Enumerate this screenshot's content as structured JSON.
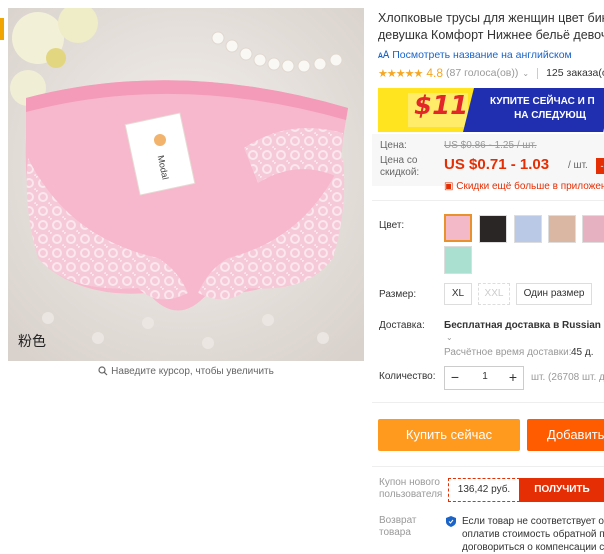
{
  "product": {
    "title_line1": "Хлопковые трусы для женщин цвет бики",
    "title_line2": "девушка Комфорт Нижнее бельё девоче",
    "translate_link": "Посмотреть название на английском",
    "rating": "4.8",
    "votes": "(87 голоса(ов))",
    "orders": "125 заказа(ов",
    "image_caption": "粉色",
    "image_tag": "Modal",
    "zoom_hint": "Наведите курсор, чтобы увеличить"
  },
  "banner": {
    "amount": "$11",
    "cta_line1": "КУПИТЕ СЕЙЧАС И П",
    "cta_line2": "НА СЛЕДУЮЩ"
  },
  "price": {
    "price_label": "Цена:",
    "old_price": "US $0.86 - 1.25 / шт.",
    "discount_label_line1": "Цена со",
    "discount_label_line2": "скидкой:",
    "sale_price": "US $0.71 - 1.03",
    "per_unit": "/ шт.",
    "app_discount": "Скидки ещё больше в приложен"
  },
  "options": {
    "color_label": "Цвет:",
    "colors": [
      "pink",
      "black",
      "blue",
      "beige",
      "light-pink",
      "mint"
    ],
    "size_label": "Размер:",
    "sizes": [
      "XL",
      "XXL",
      "Один размер"
    ]
  },
  "shipping": {
    "label": "Доставка:",
    "value": "Бесплатная доставка в Russian Fe",
    "time_label": "Расчётное время доставки:",
    "time_value": "45 д."
  },
  "quantity": {
    "label": "Количество:",
    "value": "1",
    "stock": "шт. (26708 шт. до"
  },
  "actions": {
    "buy_now": "Купить сейчас",
    "add_to_cart": "Добавить"
  },
  "coupon": {
    "label_line1": "Купон нового",
    "label_line2": "пользователя",
    "amount": "136,42 руб.",
    "button": "ПОЛУЧИТЬ"
  },
  "returns": {
    "label_line1": "Возврат",
    "label_line2": "товара",
    "line1": "Если товар не соответствует опи",
    "line2": "оплатив стоимость обратной пе",
    "line3": "договориться о компенсации с"
  },
  "colors": {
    "accent_orange": "#ff9a1f",
    "cart_orange": "#ff5c00",
    "price_red": "#e62e04",
    "banner_yellow": "#ffe41f",
    "banner_blue": "#1f2fb0",
    "link_blue": "#1a64c9"
  }
}
